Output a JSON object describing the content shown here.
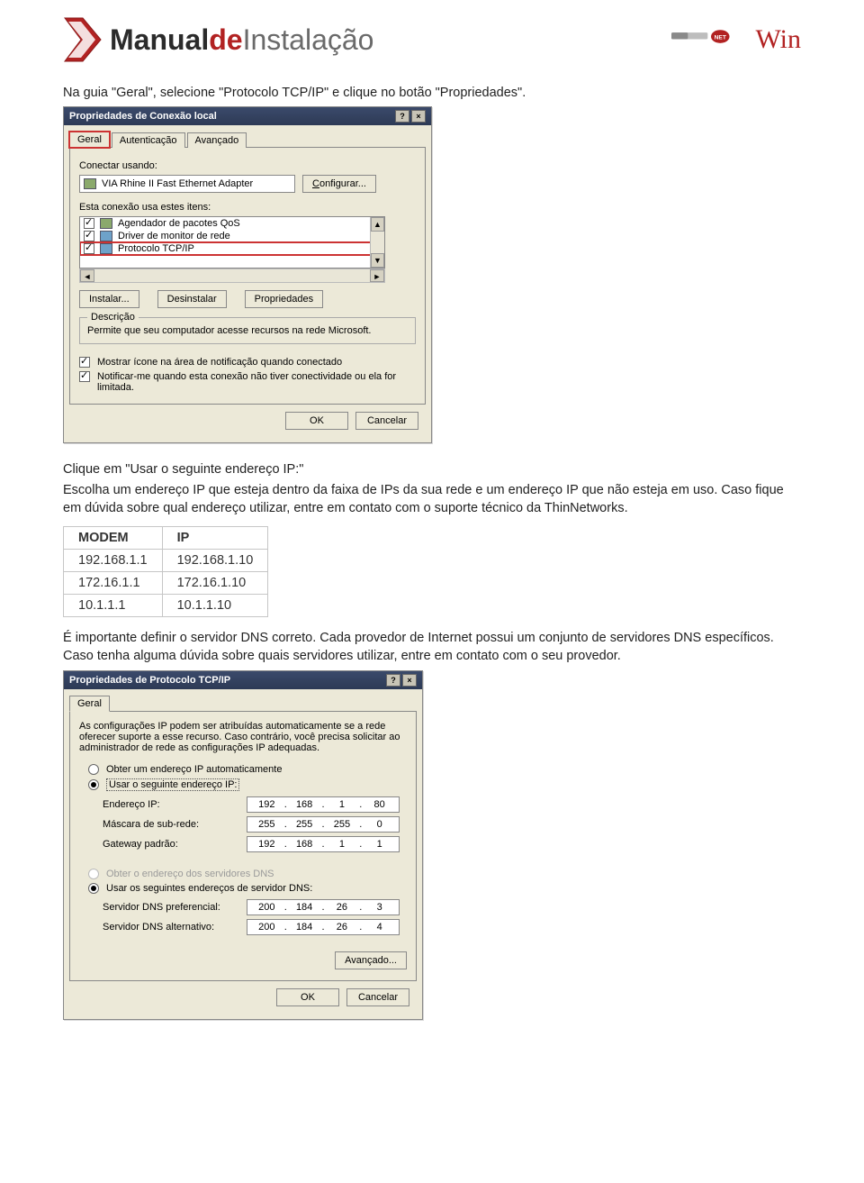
{
  "header": {
    "manual_prefix": "Manual",
    "manual_de": "de",
    "manual_suffix": "Instalação",
    "brand_right_win": "Win"
  },
  "para1": "Na guia \"Geral\", selecione \"Protocolo TCP/IP\" e clique no botão \"Propriedades\".",
  "dialog1": {
    "title": "Propriedades de Conexão local",
    "tab_geral": "Geral",
    "tab_aut": "Autenticação",
    "tab_av": "Avançado",
    "connect_using": "Conectar usando:",
    "adapter": "VIA Rhine II Fast Ethernet Adapter",
    "btn_configure": "Configurar...",
    "uses_items": "Esta conexão usa estes itens:",
    "items": [
      "Agendador de pacotes QoS",
      "Driver de monitor de rede",
      "Protocolo TCP/IP"
    ],
    "btn_install": "Instalar...",
    "btn_uninstall": "Desinstalar",
    "btn_props": "Propriedades",
    "desc_legend": "Descrição",
    "desc_text": "Permite que seu computador acesse recursos na rede Microsoft.",
    "chk_showicon": "Mostrar ícone na área de notificação quando conectado",
    "chk_notify": "Notificar-me quando esta conexão não tiver conectividade ou ela for limitada.",
    "btn_ok": "OK",
    "btn_cancel": "Cancelar"
  },
  "para2": "Clique em \"Usar o seguinte endereço IP:\"",
  "para2b": "Escolha um endereço IP que esteja dentro da faixa de IPs da sua rede e um endereço IP que não esteja em uso. Caso fique em dúvida sobre qual endereço utilizar, entre em contato com o suporte técnico da ThinNetworks.",
  "iptable": {
    "h1": "MODEM",
    "h2": "IP",
    "rows": [
      {
        "modem": "192.168.1.1",
        "ip": "192.168.1.10"
      },
      {
        "modem": "172.16.1.1",
        "ip": "172.16.1.10"
      },
      {
        "modem": "10.1.1.1",
        "ip": "10.1.1.10"
      }
    ]
  },
  "para3": "É importante definir o servidor DNS correto. Cada provedor de Internet possui um conjunto de servidores DNS específicos. Caso tenha alguma dúvida sobre quais servidores utilizar, entre em contato com o seu provedor.",
  "dialog2": {
    "title": "Propriedades de Protocolo TCP/IP",
    "tab_geral": "Geral",
    "intro": "As configurações IP podem ser atribuídas automaticamente se a rede oferecer suporte a esse recurso. Caso contrário, você precisa solicitar ao administrador de rede as configurações IP adequadas.",
    "r_auto_ip": "Obter um endereço IP automaticamente",
    "r_use_ip": "Usar o seguinte endereço IP:",
    "lbl_ip": "Endereço IP:",
    "lbl_mask": "Máscara de sub-rede:",
    "lbl_gw": "Gateway padrão:",
    "ip": [
      "192",
      "168",
      "1",
      "80"
    ],
    "mask": [
      "255",
      "255",
      "255",
      "0"
    ],
    "gw": [
      "192",
      "168",
      "1",
      "1"
    ],
    "r_auto_dns": "Obter o endereço dos servidores DNS",
    "r_use_dns": "Usar os seguintes endereços de servidor DNS:",
    "lbl_dns1": "Servidor DNS preferencial:",
    "lbl_dns2": "Servidor DNS alternativo:",
    "dns1": [
      "200",
      "184",
      "26",
      "3"
    ],
    "dns2": [
      "200",
      "184",
      "26",
      "4"
    ],
    "btn_adv": "Avançado...",
    "btn_ok": "OK",
    "btn_cancel": "Cancelar"
  }
}
